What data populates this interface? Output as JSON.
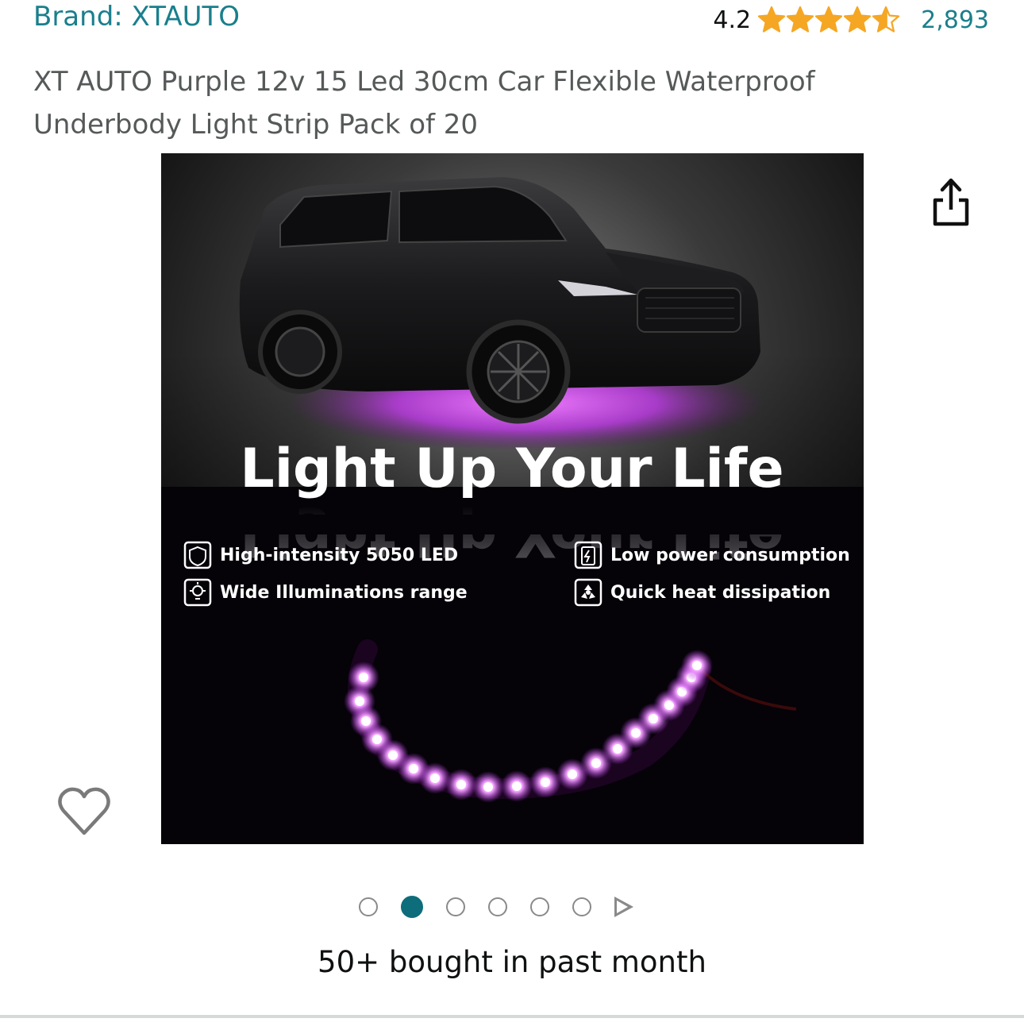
{
  "brand": {
    "label": "Brand: XTAUTO"
  },
  "rating": {
    "value": "4.2",
    "stars_filled": 4.2,
    "stars_total": 5,
    "count": "2,893",
    "star_color": "#f5a623"
  },
  "product": {
    "title": "XT AUTO Purple 12v 15 Led 30cm Car Flexible Waterproof Underbody Light Strip Pack of 20"
  },
  "image": {
    "headline": "Light Up Your Life",
    "features": [
      {
        "icon": "shield-icon",
        "text": "High-intensity 5050 LED"
      },
      {
        "icon": "battery-icon",
        "text": "Low power consumption"
      },
      {
        "icon": "bulb-icon",
        "text": "Wide Illuminations range"
      },
      {
        "icon": "fan-icon",
        "text": "Quick heat dissipation"
      }
    ],
    "glow_color": "#d84cff"
  },
  "carousel": {
    "total_dots": 6,
    "active_index": 1
  },
  "icons": {
    "share": "share-icon",
    "wishlist": "heart-icon",
    "next": "play-icon"
  },
  "colors": {
    "link": "#1a7f8c",
    "active_dot": "#0e6d7b"
  },
  "social_proof": {
    "text": "50+ bought in past month"
  }
}
